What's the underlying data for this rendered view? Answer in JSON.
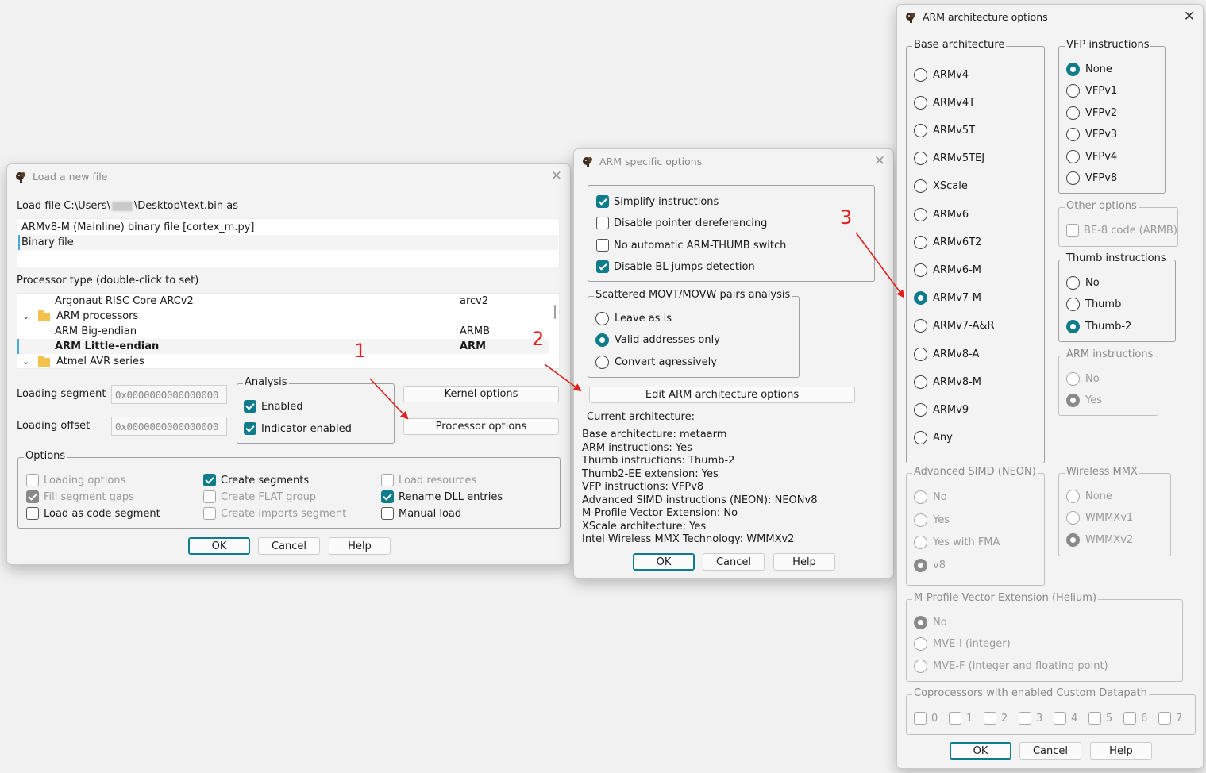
{
  "load_dialog": {
    "title": "Load a new file",
    "load_file_label": "Load file C:\\Users\\",
    "load_file_label_tail": "\\Desktop\\text.bin as",
    "file_types": [
      "ARMv8-M (Mainline) binary file [cortex_m.py]",
      "Binary file"
    ],
    "processor_label": "Processor type (double-click to set)",
    "processors": [
      {
        "name": "Argonaut RISC Core ARCv2",
        "code": "arcv2",
        "indent": 2
      },
      {
        "name": "ARM processors",
        "code": "",
        "indent": 1,
        "folder": true
      },
      {
        "name": "ARM Big-endian",
        "code": "ARMB",
        "indent": 2
      },
      {
        "name": "ARM Little-endian",
        "code": "ARM",
        "indent": 2,
        "selected": true
      },
      {
        "name": "Atmel AVR series",
        "code": "",
        "indent": 1,
        "folder": true
      }
    ],
    "loading_segment_label": "Loading segment",
    "loading_segment_value": "0x0000000000000000",
    "loading_offset_label": "Loading offset",
    "loading_offset_value": "0x0000000000000000",
    "analysis_label": "Analysis",
    "enabled_label": "Enabled",
    "indicator_label": "Indicator enabled",
    "kernel_options": "Kernel options",
    "processor_options": "Processor options",
    "options_label": "Options",
    "options": {
      "loading_options": "Loading options",
      "fill_segment_gaps": "Fill segment gaps",
      "load_as_code": "Load as code segment",
      "create_segments": "Create segments",
      "create_flat_group": "Create FLAT group",
      "create_imports": "Create imports segment",
      "load_resources": "Load resources",
      "rename_dll": "Rename DLL entries",
      "manual_load": "Manual load"
    },
    "ok": "OK",
    "cancel": "Cancel",
    "help": "Help"
  },
  "arm_specific": {
    "title": "ARM specific options",
    "simplify": "Simplify instructions",
    "disable_pointer": "Disable pointer dereferencing",
    "no_auto_switch": "No automatic ARM-THUMB switch",
    "disable_bl": "Disable BL jumps detection",
    "movt_label": "Scattered MOVT/MOVW pairs analysis",
    "leave_as_is": "Leave as is",
    "valid_only": "Valid addresses only",
    "convert_agg": "Convert agressively",
    "edit_arch": "Edit ARM architecture options",
    "current_arch": "Current architecture:",
    "info_lines": [
      "Base architecture: metaarm",
      "ARM instructions: Yes",
      "Thumb instructions: Thumb-2",
      "Thumb2-EE extension: Yes",
      "VFP instructions: VFPv8",
      "Advanced SIMD instructions (NEON): NEONv8",
      "M-Profile Vector Extension: No",
      "XScale architecture: Yes",
      "Intel Wireless MMX Technology: WMMXv2"
    ],
    "ok": "OK",
    "cancel": "Cancel",
    "help": "Help"
  },
  "arch_options": {
    "title": "ARM architecture options",
    "base_label": "Base architecture",
    "base_items": [
      "ARMv4",
      "ARMv4T",
      "ARMv5T",
      "ARMv5TEJ",
      "XScale",
      "ARMv6",
      "ARMv6T2",
      "ARMv6-M",
      "ARMv7-M",
      "ARMv7-A&R",
      "ARMv8-A",
      "ARMv8-M",
      "ARMv9",
      "Any"
    ],
    "base_selected": 8,
    "vfp_label": "VFP instructions",
    "vfp_items": [
      "None",
      "VFPv1",
      "VFPv2",
      "VFPv3",
      "VFPv4",
      "VFPv8"
    ],
    "other_label": "Other options",
    "be8": "BE-8 code (ARMB)",
    "thumb_label": "Thumb instructions",
    "thumb_items": [
      "No",
      "Thumb",
      "Thumb-2"
    ],
    "armi_label": "ARM instructions",
    "armi_items": [
      "No",
      "Yes"
    ],
    "simd_label": "Advanced SIMD (NEON)",
    "simd_items": [
      "No",
      "Yes",
      "Yes with FMA",
      "v8"
    ],
    "mmx_label": "Wireless MMX",
    "mmx_items": [
      "None",
      "WMMXv1",
      "WMMXv2"
    ],
    "mve_label": "M-Profile Vector Extension (Helium)",
    "mve_items": [
      "No",
      "MVE-I (integer)",
      "MVE-F (integer and floating point)"
    ],
    "coproc_label": "Coprocessors with enabled Custom Datapath",
    "coproc_items": [
      "0",
      "1",
      "2",
      "3",
      "4",
      "5",
      "6",
      "7"
    ],
    "ok": "OK",
    "cancel": "Cancel",
    "help": "Help"
  },
  "annotations": [
    "1",
    "2",
    "3"
  ],
  "colors": {
    "accent": "#0f7c8c",
    "arrow": "#e0201c"
  }
}
